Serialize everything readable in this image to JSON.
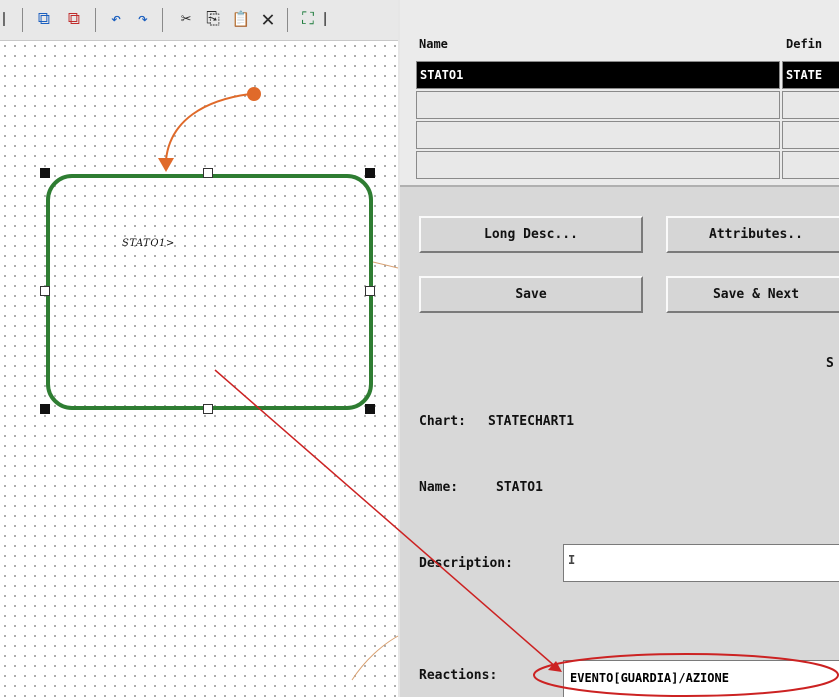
{
  "toolbar": {
    "icons": [
      "partial-icon",
      "import-icon",
      "export-icon",
      "undo-icon",
      "redo-icon",
      "cut-icon",
      "copy-icon",
      "paste-icon",
      "delete-icon",
      "zoom-fit-icon",
      "partial-right-icon"
    ],
    "glyphs": {
      "partial": "❘",
      "import": "⧉",
      "export": "⧉",
      "undo": "↶",
      "redo": "↷",
      "cut": "✂",
      "copy": "⎘",
      "paste": "📋",
      "delete": "✕",
      "zoomfit": "⛶"
    }
  },
  "canvas": {
    "state_label": "STATO1>",
    "colors": {
      "state_border": "#2e7d32",
      "transition": "#e06a2a",
      "annotation": "#cc2222"
    }
  },
  "grid": {
    "col_name": "Name",
    "col_definition": "Defin",
    "rows": [
      {
        "name": "STATO1",
        "definition": "STATE",
        "selected": true
      },
      {
        "name": "",
        "definition": "",
        "selected": false
      },
      {
        "name": "",
        "definition": "",
        "selected": false
      },
      {
        "name": "",
        "definition": "",
        "selected": false
      }
    ]
  },
  "buttons": {
    "long_desc": "Long Desc...",
    "attributes": "Attributes..",
    "save": "Save",
    "save_next": "Save & Next"
  },
  "form": {
    "section_letter": "S",
    "chart_label": "Chart:",
    "chart_value": "STATECHART1",
    "name_label": "Name:",
    "name_value": "STATO1",
    "description_label": "Description:",
    "description_value": "",
    "reactions_label": "Reactions:",
    "reactions_value": "EVENTO[GUARDIA]/AZIONE"
  }
}
